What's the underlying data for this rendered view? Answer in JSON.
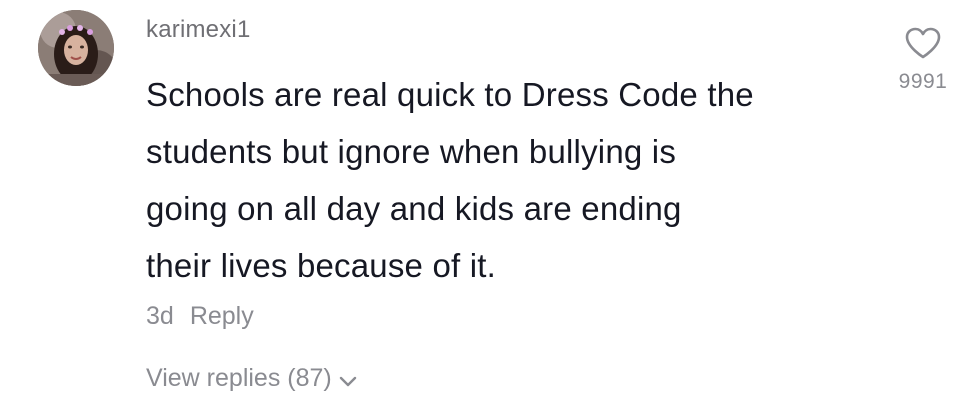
{
  "comment": {
    "username": "karimexi1",
    "text_lines": [
      "Schools are real quick to Dress Code the",
      "students but ignore when bullying is",
      "going on all day and kids are ending",
      "their lives because of it."
    ],
    "time": "3d",
    "reply_label": "Reply",
    "view_replies_label": "View replies (87)",
    "like_count": "9991",
    "icons": {
      "like": "heart-outline-icon",
      "expand": "chevron-down-icon"
    }
  }
}
